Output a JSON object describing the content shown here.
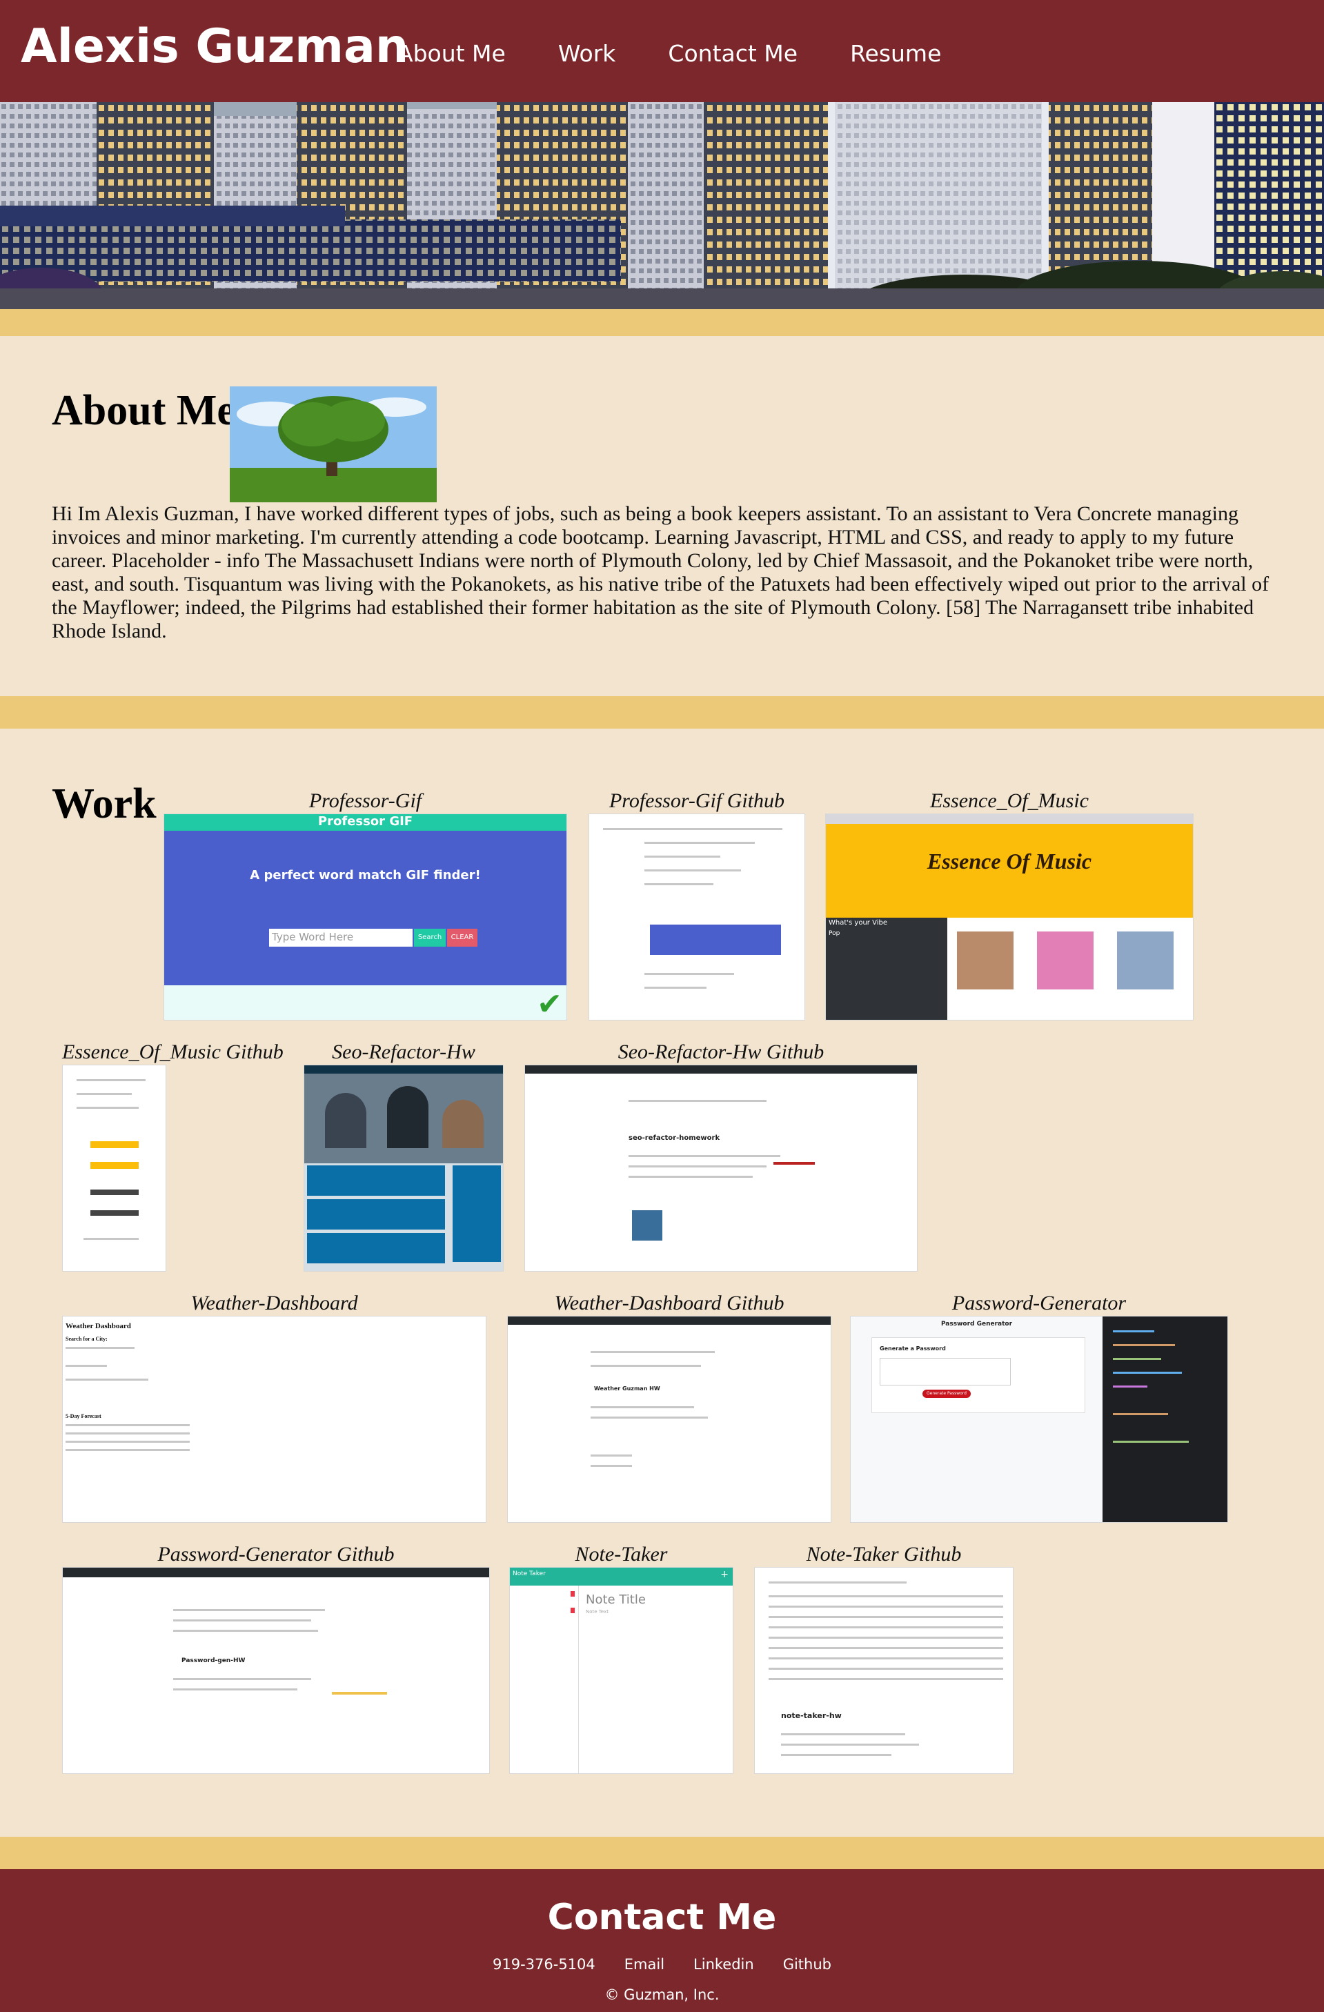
{
  "header": {
    "brand": "Alexis Guzman",
    "nav": [
      "About Me",
      "Work",
      "Contact Me",
      "Resume"
    ]
  },
  "about": {
    "title": "About Me",
    "text": "Hi Im Alexis Guzman, I have worked different types of jobs, such as being a book keepers assistant. To an assistant to Vera Concrete managing invoices and minor marketing. I'm currently attending a code bootcamp. Learning Javascript, HTML and CSS, and ready to apply to my future career. Placeholder - info The Massachusett Indians were north of Plymouth Colony, led by Chief Massasoit, and the Pokanoket tribe were north, east, and south. Tisquantum was living with the Pokanokets, as his native tribe of the Patuxets had been effectively wiped out prior to the arrival of the Mayflower; indeed, the Pilgrims had established their former habitation as the site of Plymouth Colony. [58] The Narragansett tribe inhabited Rhode Island.",
    "image_icon": "tree-photo"
  },
  "work": {
    "title": "Work",
    "items": [
      {
        "caption": "Professor-Gif",
        "screenshot_text": {
          "title": "Professor GIF",
          "tagline": "A perfect word match GIF finder!",
          "placeholder": "Type Word Here",
          "search": "Search",
          "clear": "CLEAR"
        }
      },
      {
        "caption": "Professor-Gif Github"
      },
      {
        "caption": "Essence_Of_Music",
        "screenshot_text": {
          "logo": "Essence Of Music",
          "sidebar": "What's your Vibe",
          "genre": "Pop"
        }
      },
      {
        "caption": "Essence_Of_Music Github"
      },
      {
        "caption": "Seo-Refactor-Hw"
      },
      {
        "caption": "Seo-Refactor-Hw Github",
        "screenshot_text": {
          "heading": "seo-refactor-homework"
        }
      },
      {
        "caption": "Weather-Dashboard",
        "screenshot_text": {
          "heading": "Weather Dashboard",
          "search": "Search for a City:",
          "forecast": "5-Day Forecast"
        }
      },
      {
        "caption": "Weather-Dashboard Github",
        "screenshot_text": {
          "heading": "Weather Guzman HW"
        }
      },
      {
        "caption": "Password-Generator",
        "screenshot_text": {
          "heading": "Password Generator",
          "card": "Generate a Password",
          "button": "Generate Password"
        }
      },
      {
        "caption": "Password-Generator Github",
        "screenshot_text": {
          "heading": "Password-gen-HW"
        }
      },
      {
        "caption": "Note-Taker",
        "screenshot_text": {
          "app": "Note Taker",
          "title": "Note Title",
          "text": "Note Text"
        }
      },
      {
        "caption": "Note-Taker Github",
        "screenshot_text": {
          "heading": "note-taker-hw"
        }
      }
    ]
  },
  "footer": {
    "title": "Contact Me",
    "phone": "919-376-5104",
    "links": [
      "Email",
      "Linkedin",
      "Github"
    ],
    "copyright": "© Guzman, Inc."
  },
  "colors": {
    "header_bg": "#7c272b",
    "page_bg": "#f2e4cf",
    "band": "#ebc979"
  }
}
